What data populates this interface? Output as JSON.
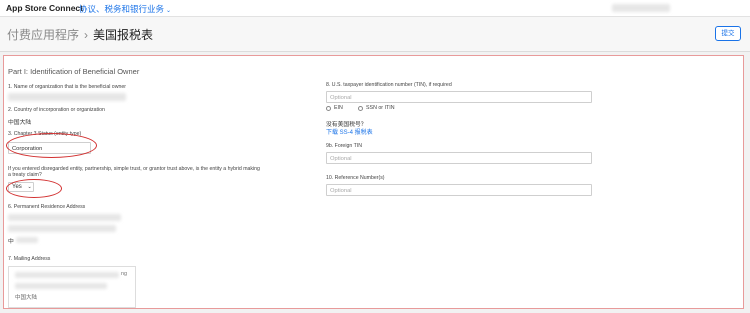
{
  "topbar": {
    "brand": "App Store Connect",
    "menu_label": "协议、税务和银行业务",
    "menu_chevron": "⌄"
  },
  "header": {
    "breadcrumb_parent": "付费应用程序",
    "breadcrumb_sep": "›",
    "breadcrumb_current": "美国报税表",
    "submit_label": "提交"
  },
  "form": {
    "part_title": "Part I: Identification of Beneficial Owner",
    "left": {
      "org_name_label": "1. Name of organization that is the beneficial owner",
      "country_label": "2. Country of incorporation or organization",
      "country_value": "中国大陆",
      "chapter3_label": "3. Chapter 3 Status (entity type)",
      "chapter3_value": "Corporation",
      "hybrid_label_line1": "If you entered disregarded entity, partnership, simple trust, or grantor trust above, is the entity a hybrid making",
      "hybrid_label_line2": "a treaty claim?",
      "hybrid_value": "Yes",
      "select_chevron": "⌄",
      "permanent_label": "6. Permanent Residence Address",
      "permanent_fragment": "中",
      "mailing_label": "7. Mailing Address",
      "mailing_fragment1": "ng",
      "mailing_fragment2": "中国大陆"
    },
    "right": {
      "tin_label": "8. U.S. taxpayer identification number (TIN), if required",
      "tin_placeholder": "Optional",
      "radio_ein": "EIN",
      "radio_ssn": "SSN or ITIN",
      "no_tin_text": "没有美国税号？",
      "download_link": "下载 SS-4 报税表",
      "foreign_tin_label": "9b. Foreign TIN",
      "foreign_tin_placeholder": "Optional",
      "reference_label": "10. Reference Number(s)",
      "reference_placeholder": "Optional"
    }
  }
}
